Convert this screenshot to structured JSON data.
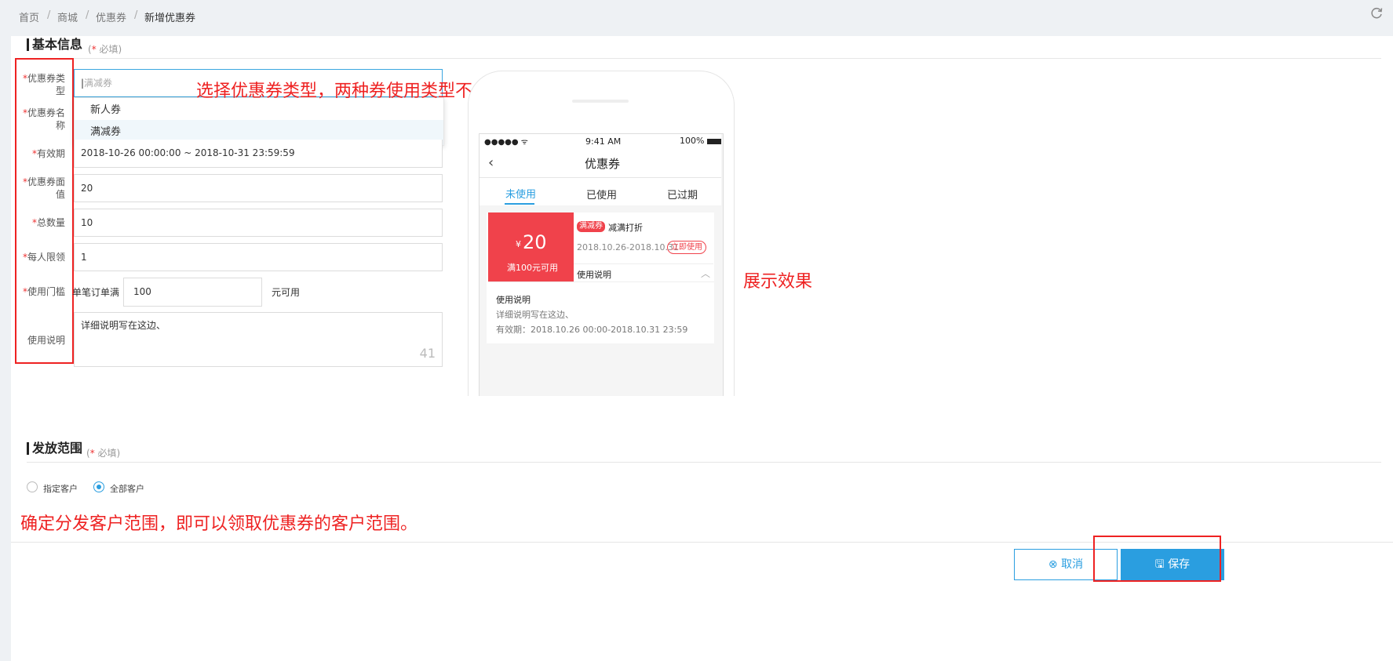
{
  "breadcrumb": {
    "items": [
      "首页",
      "商城",
      "优惠券",
      "新增优惠券"
    ],
    "separator": "/"
  },
  "section_basic": {
    "title": "基本信息",
    "required_star": "*",
    "required_hint": "必填"
  },
  "form": {
    "type": {
      "star": "*",
      "label_line1": "优惠券类",
      "label_line2": "型",
      "placeholder": "满减券",
      "options": [
        "新人券",
        "满减券"
      ],
      "selected_option": "满减券"
    },
    "name": {
      "star": "*",
      "label_line1": "优惠券名",
      "label_line2": "称"
    },
    "period": {
      "star": "*",
      "label": "有效期",
      "value": "2018-10-26 00:00:00 ~ 2018-10-31 23:59:59"
    },
    "face": {
      "star": "*",
      "label_line1": "优惠券面",
      "label_line2": "值",
      "value": "20"
    },
    "total": {
      "star": "*",
      "label": "总数量",
      "value": "10"
    },
    "limit": {
      "star": "*",
      "label": "每人限领",
      "value": "1"
    },
    "threshold": {
      "star": "*",
      "label": "使用门槛",
      "prefix": "单笔订单满",
      "value": "100",
      "suffix": "元可用"
    },
    "desc": {
      "label": "使用说明",
      "value": "详细说明写在这边、",
      "counter": "41"
    }
  },
  "annotations": {
    "type_note": "选择优惠券类型，两种券使用类型不一样。",
    "preview_note": "展示效果",
    "scope_note": "确定分发客户范围，即可以领取优惠券的客户范围。"
  },
  "phone": {
    "status": {
      "signal": "●●●●● ᯤ",
      "time": "9:41 AM",
      "battery": "100%"
    },
    "title": "优惠券",
    "back_icon": "chevron-left-icon",
    "tabs": [
      "未使用",
      "已使用",
      "已过期"
    ],
    "active_tab": "未使用",
    "coupon": {
      "currency": "¥",
      "amount": "20",
      "condition": "满100元可用",
      "tag": "满减券",
      "name": "减满打折",
      "date_range": "2018.10.26-2018.10.31",
      "use_button": "立即使用",
      "desc_toggle": "使用说明",
      "detail_title": "使用说明",
      "detail_text": "详细说明写在这边、",
      "detail_validity": "有效期：2018.10.26 00:00-2018.10.31 23:59"
    }
  },
  "section_scope": {
    "title": "发放范围",
    "required_star": "*",
    "required_hint": "必填"
  },
  "scope": {
    "options": [
      "指定客户",
      "全部客户"
    ],
    "selected": "全部客户"
  },
  "footer": {
    "cancel_label": "取消",
    "cancel_icon": "close-circle-icon",
    "save_label": "保存",
    "save_icon": "save-icon"
  },
  "colors": {
    "accent": "#2a9ee0",
    "annotation_red": "#e22222",
    "coupon_red": "#f0424b"
  }
}
